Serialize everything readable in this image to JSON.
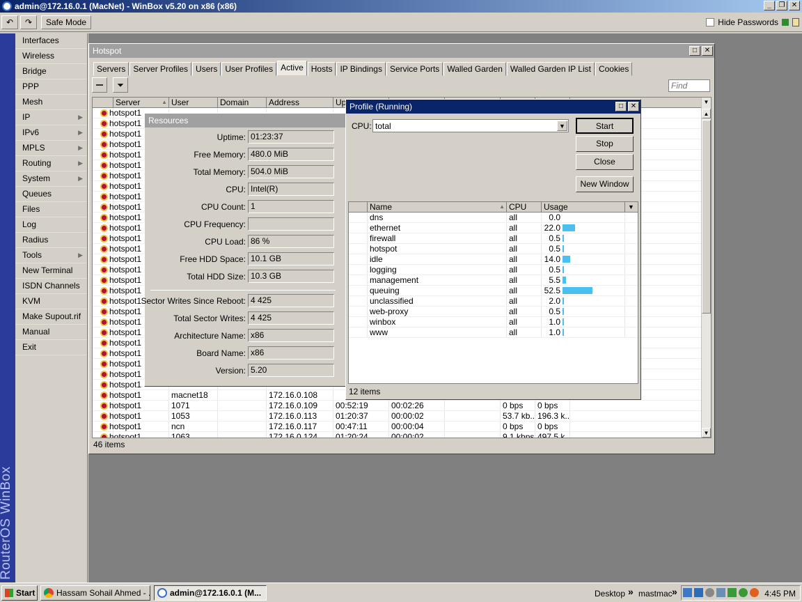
{
  "window": {
    "title": "admin@172.16.0.1 (MacNet) - WinBox v5.20 on x86 (x86)"
  },
  "toolbar": {
    "undo": "↶",
    "redo": "↷",
    "safe_mode": "Safe Mode",
    "hide_passwords": "Hide Passwords"
  },
  "brand": "RouterOS WinBox",
  "sidebar": {
    "items": [
      {
        "label": "Interfaces",
        "arrow": ""
      },
      {
        "label": "Wireless",
        "arrow": ""
      },
      {
        "label": "Bridge",
        "arrow": ""
      },
      {
        "label": "PPP",
        "arrow": ""
      },
      {
        "label": "Mesh",
        "arrow": ""
      },
      {
        "label": "IP",
        "arrow": "▶"
      },
      {
        "label": "IPv6",
        "arrow": "▶"
      },
      {
        "label": "MPLS",
        "arrow": "▶"
      },
      {
        "label": "Routing",
        "arrow": "▶"
      },
      {
        "label": "System",
        "arrow": "▶"
      },
      {
        "label": "Queues",
        "arrow": ""
      },
      {
        "label": "Files",
        "arrow": ""
      },
      {
        "label": "Log",
        "arrow": ""
      },
      {
        "label": "Radius",
        "arrow": ""
      },
      {
        "label": "Tools",
        "arrow": "▶"
      },
      {
        "label": "New Terminal",
        "arrow": ""
      },
      {
        "label": "ISDN Channels",
        "arrow": ""
      },
      {
        "label": "KVM",
        "arrow": ""
      },
      {
        "label": "Make Supout.rif",
        "arrow": ""
      },
      {
        "label": "Manual",
        "arrow": ""
      },
      {
        "label": "Exit",
        "arrow": ""
      }
    ]
  },
  "hotspot": {
    "title": "Hotspot",
    "tabs": [
      "Servers",
      "Server Profiles",
      "Users",
      "User Profiles",
      "Active",
      "Hosts",
      "IP Bindings",
      "Service Ports",
      "Walled Garden",
      "Walled Garden IP List",
      "Cookies"
    ],
    "selected_tab": "Active",
    "find_placeholder": "Find",
    "columns": [
      "Server",
      "User",
      "Domain",
      "Address",
      "Upti"
    ],
    "sort_indicator": "▲",
    "rows_hidden_server": "hotspot1",
    "rows": [
      {
        "server": "hotspot1",
        "user": "macnet18",
        "domain": "",
        "address": "172.16.0.108",
        "uptime": "",
        "idle": "",
        "rx": "",
        "tx": ""
      },
      {
        "server": "hotspot1",
        "user": "1071",
        "domain": "",
        "address": "172.16.0.109",
        "uptime": "00:52:19",
        "idle": "00:02:26",
        "rx": "0 bps",
        "tx": "0 bps"
      },
      {
        "server": "hotspot1",
        "user": "1053",
        "domain": "",
        "address": "172.16.0.113",
        "uptime": "01:20:37",
        "idle": "00:00:02",
        "rx": "53.7 kb...",
        "tx": "196.3 k..."
      },
      {
        "server": "hotspot1",
        "user": "ncn",
        "domain": "",
        "address": "172.16.0.117",
        "uptime": "00:47:11",
        "idle": "00:00:04",
        "rx": "0 bps",
        "tx": "0 bps"
      },
      {
        "server": "hotspot1",
        "user": "1063",
        "domain": "",
        "address": "172.16.0.124",
        "uptime": "01:20:24",
        "idle": "00:00:02",
        "rx": "9.1 kbps",
        "tx": "497.5 k"
      }
    ],
    "items_count": "46 items"
  },
  "resources": {
    "title": "Resources",
    "fields": [
      {
        "label": "Uptime:",
        "value": "01:23:37"
      },
      {
        "label": "Free Memory:",
        "value": "480.0 MiB"
      },
      {
        "label": "Total Memory:",
        "value": "504.0 MiB"
      },
      {
        "label": "CPU:",
        "value": "Intel(R)"
      },
      {
        "label": "CPU Count:",
        "value": "1"
      },
      {
        "label": "CPU Frequency:",
        "value": ""
      },
      {
        "label": "CPU Load:",
        "value": "86 %"
      },
      {
        "label": "Free HDD Space:",
        "value": "10.1 GB"
      },
      {
        "label": "Total HDD Size:",
        "value": "10.3 GB"
      },
      {
        "label": "Sector Writes Since Reboot:",
        "value": "4 425"
      },
      {
        "label": "Total Sector Writes:",
        "value": "4 425"
      },
      {
        "label": "Architecture Name:",
        "value": "x86"
      },
      {
        "label": "Board Name:",
        "value": "x86"
      },
      {
        "label": "Version:",
        "value": "5.20"
      }
    ]
  },
  "profile": {
    "title": "Profile (Running)",
    "cpu_label": "CPU:",
    "cpu_value": "total",
    "buttons": {
      "start": "Start",
      "stop": "Stop",
      "close": "Close",
      "new_window": "New Window"
    },
    "columns": [
      "Name",
      "CPU",
      "Usage"
    ],
    "rows": [
      {
        "name": "dns",
        "cpu": "all",
        "usage": "0.0",
        "pct": 0.0
      },
      {
        "name": "ethernet",
        "cpu": "all",
        "usage": "22.0",
        "pct": 22.0
      },
      {
        "name": "firewall",
        "cpu": "all",
        "usage": "0.5",
        "pct": 0.5
      },
      {
        "name": "hotspot",
        "cpu": "all",
        "usage": "0.5",
        "pct": 0.5
      },
      {
        "name": "idle",
        "cpu": "all",
        "usage": "14.0",
        "pct": 14.0
      },
      {
        "name": "logging",
        "cpu": "all",
        "usage": "0.5",
        "pct": 0.5
      },
      {
        "name": "management",
        "cpu": "all",
        "usage": "5.5",
        "pct": 5.5
      },
      {
        "name": "queuing",
        "cpu": "all",
        "usage": "52.5",
        "pct": 52.5
      },
      {
        "name": "unclassified",
        "cpu": "all",
        "usage": "2.0",
        "pct": 2.0
      },
      {
        "name": "web-proxy",
        "cpu": "all",
        "usage": "0.5",
        "pct": 0.5
      },
      {
        "name": "winbox",
        "cpu": "all",
        "usage": "1.0",
        "pct": 1.0
      },
      {
        "name": "www",
        "cpu": "all",
        "usage": "1.0",
        "pct": 1.0
      }
    ],
    "items_count": "12 items"
  },
  "taskbar": {
    "start": "Start",
    "tasks": [
      {
        "label": "Hassam Sohail Ahmed - ..."
      },
      {
        "label": "admin@172.16.0.1 (M..."
      }
    ],
    "desktop": "Desktop",
    "mastmac": "mastmac",
    "chevron": "»",
    "clock": "4:45 PM"
  },
  "colors": {
    "accent": "#0a246a",
    "usage_bar": "#4bbfee",
    "brand_bg": "#2b3b9b"
  }
}
